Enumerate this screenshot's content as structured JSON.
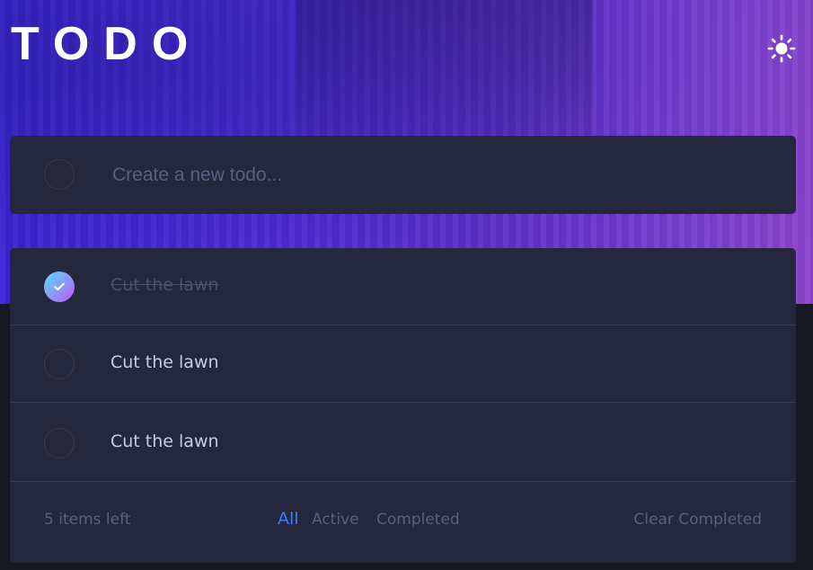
{
  "header": {
    "title": "TODO",
    "theme_icon": "sun-icon"
  },
  "new_todo": {
    "placeholder": "Create a new todo..."
  },
  "todos": [
    {
      "text": "Cut the lawn",
      "completed": true
    },
    {
      "text": "Cut the lawn",
      "completed": false
    },
    {
      "text": "Cut the lawn",
      "completed": false
    }
  ],
  "footer": {
    "items_left": "5 items left",
    "filters": {
      "all": "All",
      "active": "Active",
      "completed": "Completed"
    },
    "selected_filter": "All",
    "clear_label": "Clear Completed"
  },
  "colors": {
    "background": "#171823",
    "card": "#25273d",
    "accent": "#3a7cfd",
    "check_gradient_start": "#55ddff",
    "check_gradient_end": "#c058f3"
  }
}
